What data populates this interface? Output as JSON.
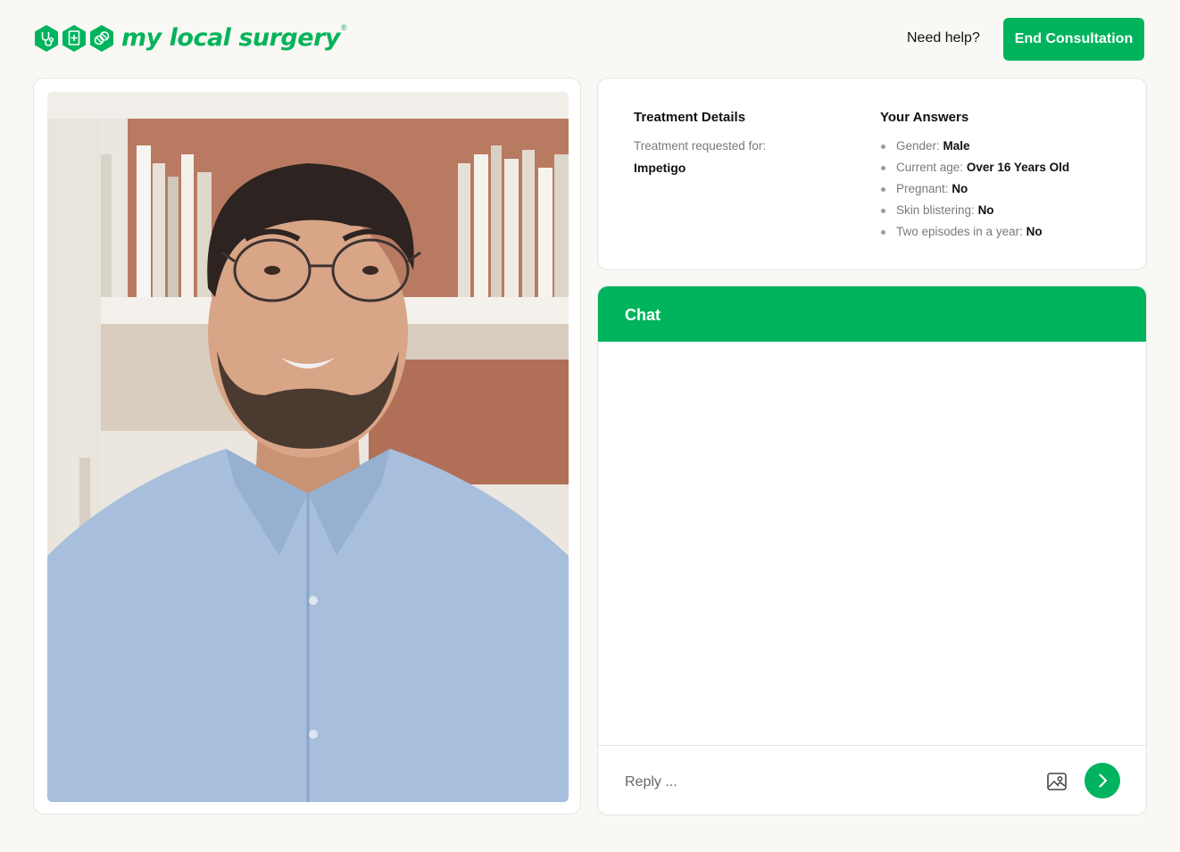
{
  "header": {
    "brand_name": "my local surgery",
    "brand_mark": "®",
    "logo_icons": [
      "stethoscope-icon",
      "document-plus-icon",
      "pills-icon"
    ],
    "help_label": "Need help?",
    "end_button_label": "End Consultation"
  },
  "colors": {
    "brand_green": "#00b45d",
    "background": "#f9f8f4",
    "muted_text": "#7a7a7a"
  },
  "video": {
    "description_icon": "video-feed-person"
  },
  "treatment": {
    "title": "Treatment Details",
    "requested_label": "Treatment requested for:",
    "requested_value": "Impetigo"
  },
  "answers": {
    "title": "Your Answers",
    "items": [
      {
        "question": "Gender:",
        "answer": "Male"
      },
      {
        "question": "Current age:",
        "answer": "Over 16 Years Old"
      },
      {
        "question": "Pregnant:",
        "answer": "No"
      },
      {
        "question": "Skin blistering:",
        "answer": "No"
      },
      {
        "question": "Two episodes in a year:",
        "answer": "No"
      }
    ]
  },
  "chat": {
    "title": "Chat",
    "reply_placeholder": "Reply ...",
    "attach_icon": "image-icon",
    "send_icon": "chevron-right-icon"
  }
}
